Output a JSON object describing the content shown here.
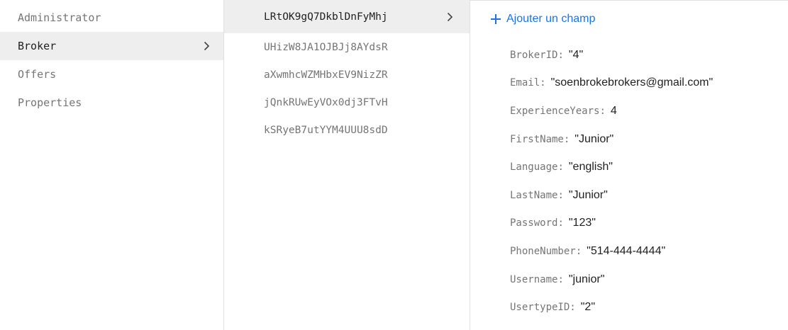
{
  "collections": {
    "items": [
      {
        "label": "Administrator",
        "selected": false
      },
      {
        "label": "Broker",
        "selected": true
      },
      {
        "label": "Offers",
        "selected": false
      },
      {
        "label": "Properties",
        "selected": false
      }
    ]
  },
  "documents": {
    "items": [
      {
        "label": "LRtOK9gQ7DkblDnFyMhj",
        "selected": true
      },
      {
        "label": "UHizW8JA1OJBJj8AYdsR",
        "selected": false
      },
      {
        "label": "aXwmhcWZMHbxEV9NizZR",
        "selected": false
      },
      {
        "label": "jQnkRUwEyVOx0dj3FTvH",
        "selected": false
      },
      {
        "label": "kSRyeB7utYYM4UUU8sdD",
        "selected": false
      }
    ]
  },
  "fields_panel": {
    "add_field_label": "Ajouter un champ",
    "fields": [
      {
        "key": "BrokerID",
        "value": "\"4\""
      },
      {
        "key": "Email",
        "value": "\"soenbrokebrokers@gmail.com\""
      },
      {
        "key": "ExperienceYears",
        "value": "4"
      },
      {
        "key": "FirstName",
        "value": "\"Junior\""
      },
      {
        "key": "Language",
        "value": "\"english\""
      },
      {
        "key": "LastName",
        "value": "\"Junior\""
      },
      {
        "key": "Password",
        "value": "\"123\""
      },
      {
        "key": "PhoneNumber",
        "value": "\"514-444-4444\""
      },
      {
        "key": "Username",
        "value": "\"junior\""
      },
      {
        "key": "UsertypeID",
        "value": "\"2\""
      }
    ]
  },
  "colors": {
    "accent": "#1a73e8",
    "selected_bg": "#eeeeee",
    "muted_text": "#757575",
    "text": "#212121"
  }
}
